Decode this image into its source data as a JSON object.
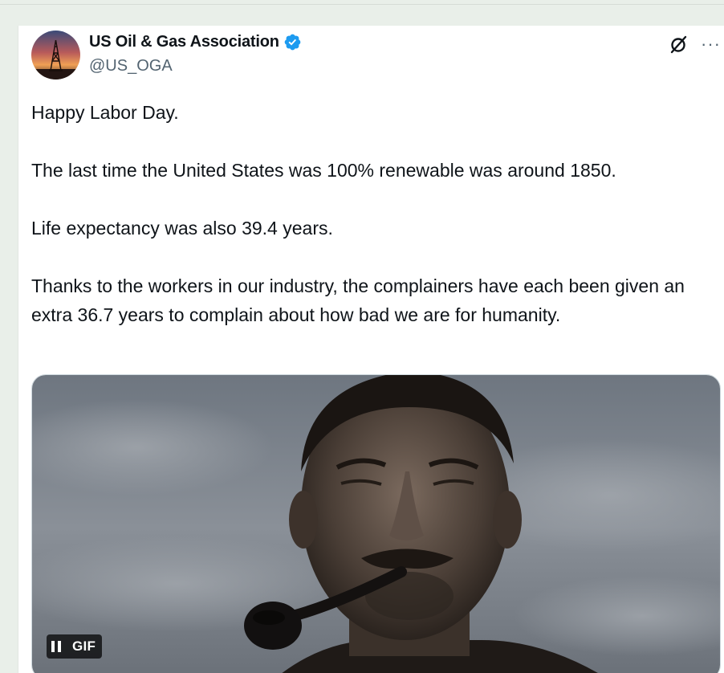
{
  "account": {
    "display_name": "US Oil & Gas Association",
    "handle": "@US_OGA",
    "verified": true,
    "avatar_icon": "oil-derrick-sunset-avatar"
  },
  "actions": {
    "grok_icon": "grok-icon",
    "more_label": "···"
  },
  "tweet": {
    "paragraphs": [
      "Happy Labor Day.",
      "The last time the United States was 100% renewable was around 1850.",
      "Life expectancy was also 39.4 years.",
      "Thanks to the workers in our industry, the complainers have each been given an extra 36.7 years to complain about how bad we are for humanity."
    ]
  },
  "media": {
    "type": "gif",
    "gif_label": "GIF",
    "pause_icon": "pause-icon"
  },
  "colors": {
    "verified_blue": "#1d9bf0",
    "text_primary": "#0f1419",
    "text_secondary": "#536471",
    "page_background": "#e9efe9"
  }
}
